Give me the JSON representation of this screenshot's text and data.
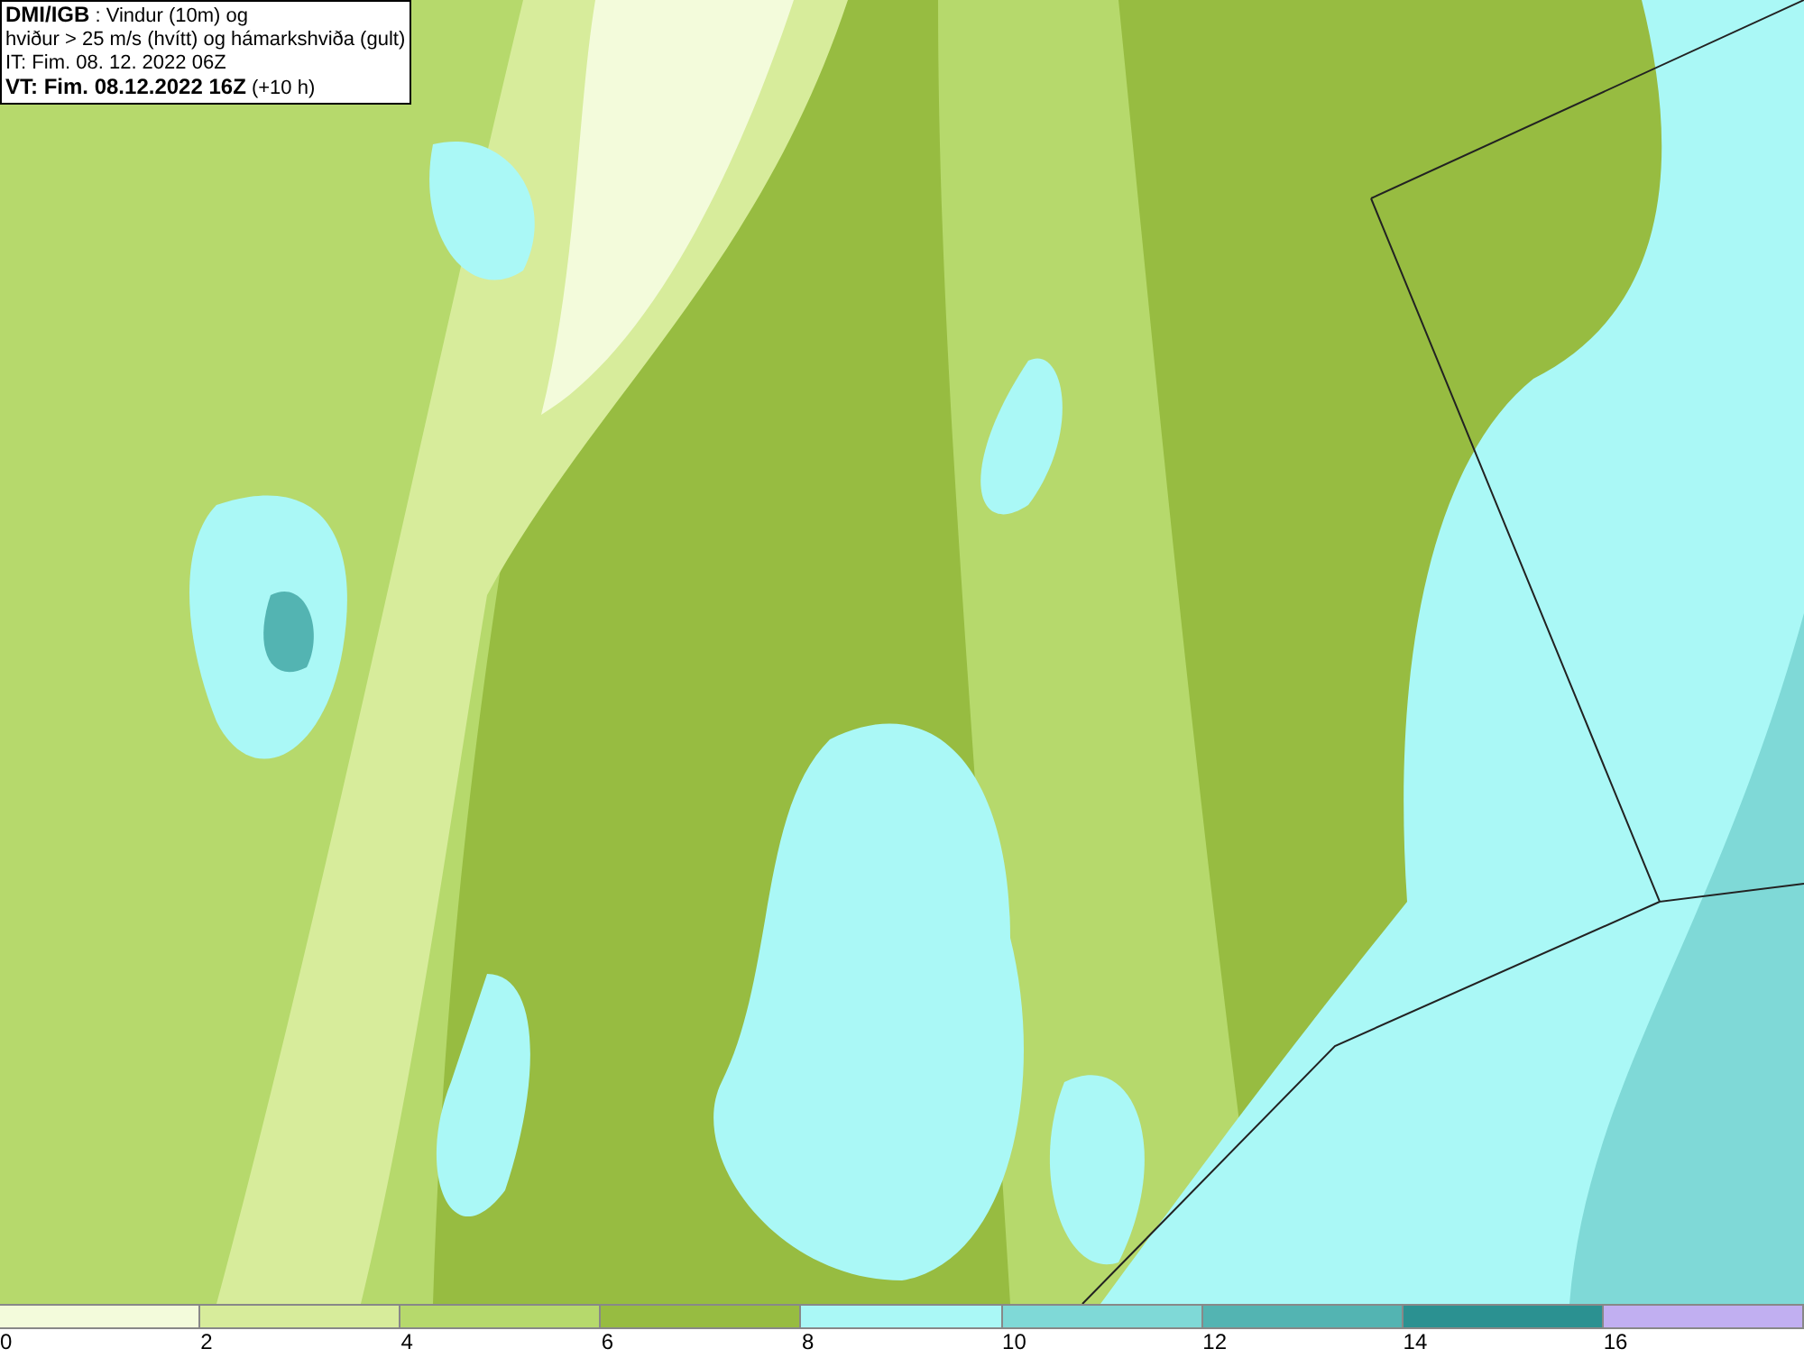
{
  "title_box": {
    "lines": [
      "**DMI/IGB** : Vindur (10m) og",
      "hviður > 25 m/s (hvítt) og hámarkshviða (gult)",
      "IT: Fim. 08. 12. 2022 06Z",
      "**VT: Fim. 08.12.2022 16Z** (+10 h)"
    ]
  },
  "legend": [
    {
      "label": "0",
      "color": "#f3fbdb"
    },
    {
      "label": "2",
      "color": "#d7ec9b"
    },
    {
      "label": "4",
      "color": "#b6d96c"
    },
    {
      "label": "6",
      "color": "#97bc41"
    },
    {
      "label": "8",
      "color": "#aaf8f6"
    },
    {
      "label": "10",
      "color": "#7fd9d7"
    },
    {
      "label": "12",
      "color": "#53b4b2"
    },
    {
      "label": "14",
      "color": "#2b9191"
    },
    {
      "label": "16",
      "color": "#c1aff1"
    }
  ]
}
